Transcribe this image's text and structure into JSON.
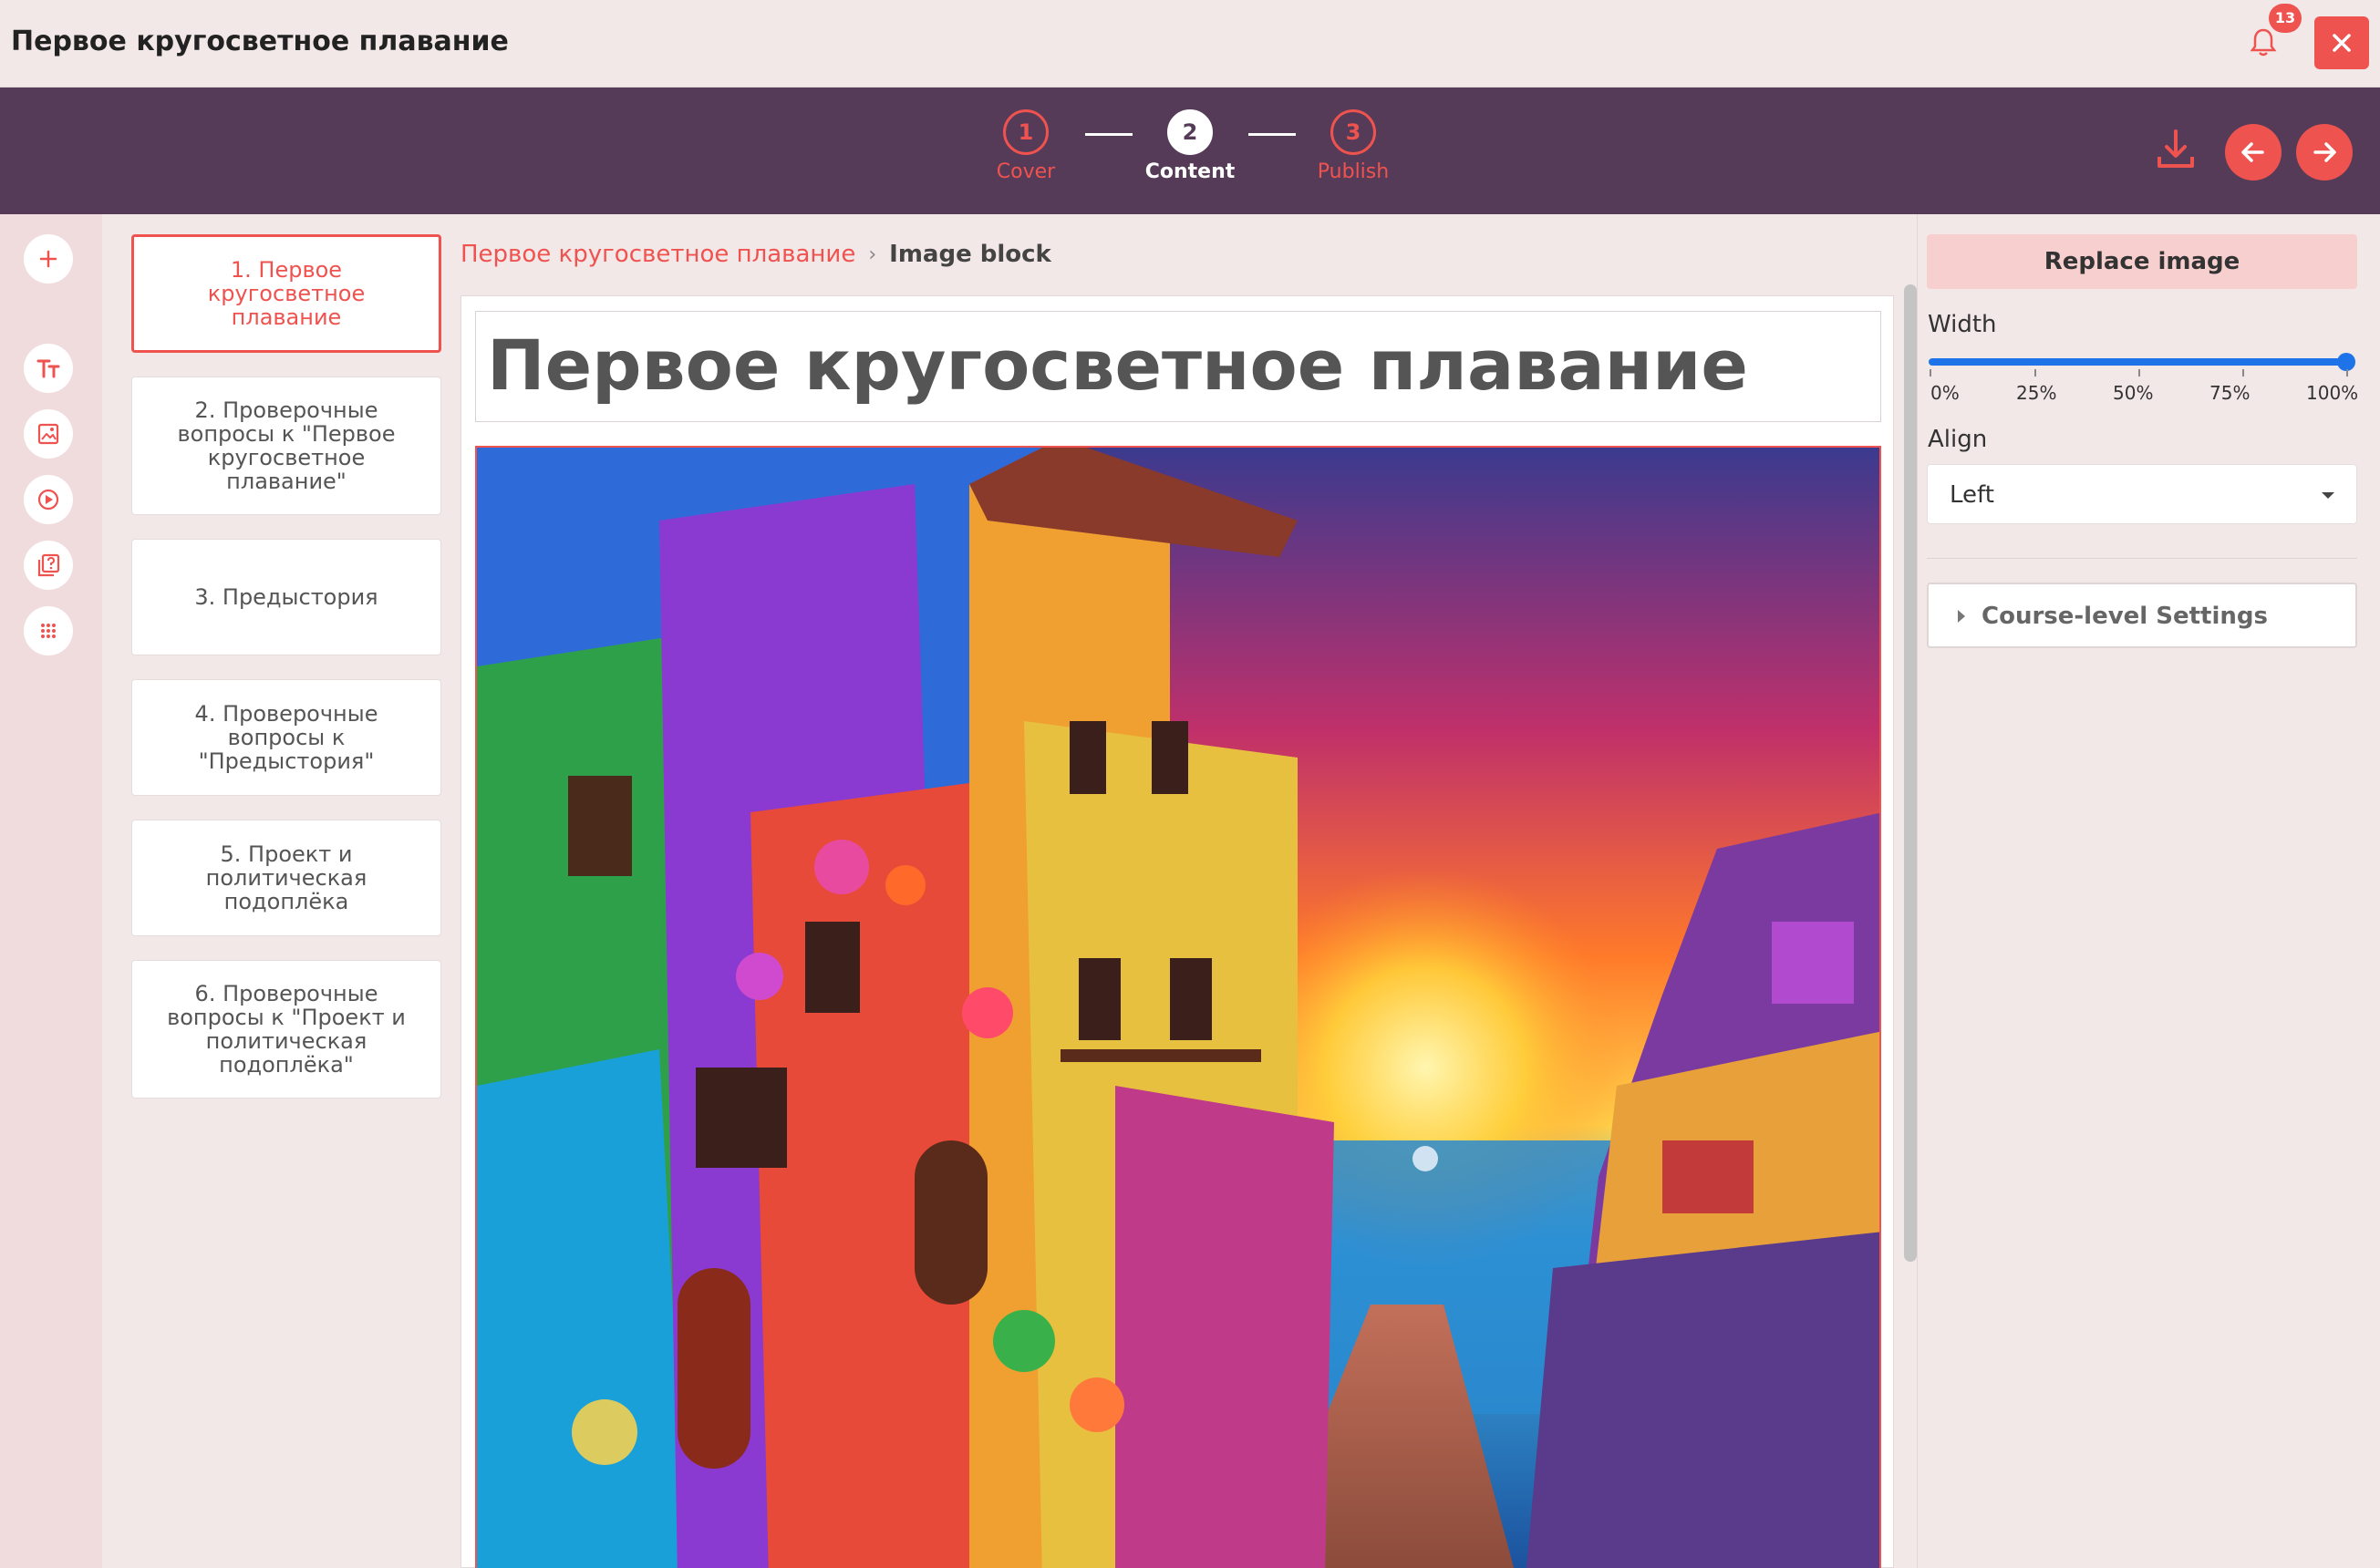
{
  "app": {
    "title": "Первое кругосветное плавание",
    "notification_count": "13"
  },
  "stepper": {
    "steps": [
      {
        "number": "1",
        "label": "Cover"
      },
      {
        "number": "2",
        "label": "Content"
      },
      {
        "number": "3",
        "label": "Publish"
      }
    ],
    "active_step": 2
  },
  "rail": {
    "tools": [
      "add-icon",
      "text-icon",
      "image-icon",
      "video-icon",
      "quiz-icon",
      "grid-icon"
    ]
  },
  "outline": {
    "items": [
      {
        "label": "1. Первое кругосветное плавание",
        "active": true
      },
      {
        "label": "2. Проверочные вопросы к \"Первое кругосветное плавание\""
      },
      {
        "label": "3. Предыстория"
      },
      {
        "label": "4. Проверочные вопросы к \"Предыстория\""
      },
      {
        "label": "5. Проект и политическая подоплёка"
      },
      {
        "label": "6. Проверочные вопросы к \"Проект и политическая подоплёка\""
      }
    ]
  },
  "breadcrumb": {
    "parent": "Первое кругосветное плавание",
    "separator": "›",
    "current": "Image block"
  },
  "editor": {
    "title": "Первое кругосветное плавание"
  },
  "panel": {
    "replace_label": "Replace image",
    "width_label": "Width",
    "width_value": 1.0,
    "width_marks": [
      "0%",
      "25%",
      "50%",
      "75%",
      "100%"
    ],
    "align_label": "Align",
    "align_value": "Left",
    "course_settings_label": "Course-level Settings"
  },
  "colors": {
    "accent": "#ef5350",
    "header_bg": "#553b57",
    "slider": "#1e73e8"
  }
}
